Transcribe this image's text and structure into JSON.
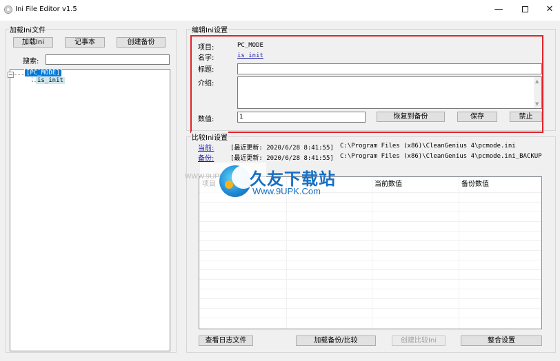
{
  "window": {
    "title": "Ini File Editor v1.5",
    "min_glyph": "—",
    "close_glyph": "✕"
  },
  "load_group": {
    "label": "加载Ini文件",
    "btn_load": "加载Ini",
    "btn_notepad": "记事本",
    "btn_backup": "创建备份",
    "search_label": "搜索:",
    "search_value": ""
  },
  "tree": {
    "expander": "−",
    "root": "[PC_MODE]",
    "child": "is_init"
  },
  "edit_group": {
    "label": "编辑Ini设置",
    "item_label": "项目:",
    "item_value": "PC_MODE",
    "name_label": "名字:",
    "name_value": "is_init",
    "title_label": "标题:",
    "title_value": "",
    "desc_label": "介绍:",
    "desc_value": "",
    "value_label": "数值:",
    "value_value": "1",
    "btn_restore": "恢复到备份",
    "btn_save": "保存",
    "btn_disable": "禁止"
  },
  "compare_group": {
    "label": "比较Ini设置",
    "current_label": "当前:",
    "current_info": "[最近更新: 2020/6/28 8:41:55]",
    "current_path": "C:\\Program Files (x86)\\CleanGenius 4\\pcmode.ini",
    "backup_label": "备份:",
    "backup_info": "[最近更新: 2020/6/28 8:41:55]",
    "backup_path": "C:\\Program Files (x86)\\CleanGenius 4\\pcmode.ini_BACKUP",
    "columns": [
      "项目",
      "",
      "当前数值",
      "备份数值"
    ],
    "btn_log": "查看日志文件",
    "btn_load_compare": "加载备份/比较",
    "btn_create_compare": "创建比较Ini",
    "btn_merge": "整合设置"
  },
  "watermark": {
    "cn": "久友下载站",
    "en": "Www.9UPK.Com",
    "side": "WWW.9UPK.COM"
  }
}
